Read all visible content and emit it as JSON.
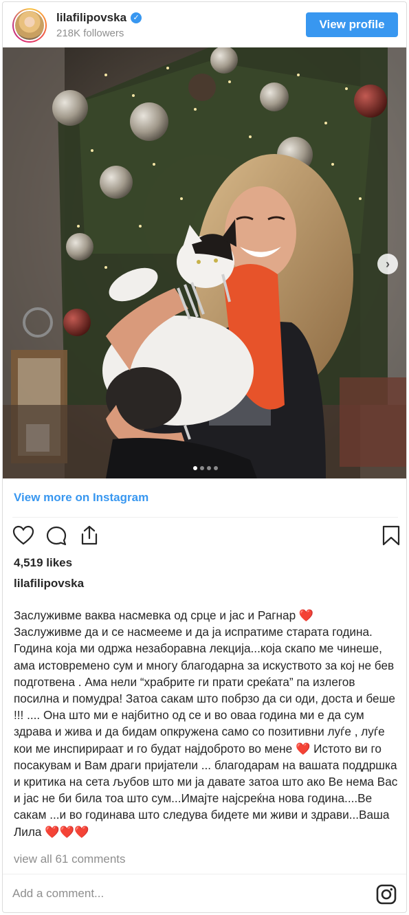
{
  "header": {
    "username": "lilafilipovska",
    "verified_mark": "✓",
    "followers": "218K followers",
    "view_profile_label": "View profile"
  },
  "media": {
    "alt": "lilafilipovska post photo",
    "slide_count": 4,
    "active_slide": 1
  },
  "view_more_label": "View more on Instagram",
  "actions": {
    "like_icon": "heart-icon",
    "comment_icon": "comment-icon",
    "share_icon": "share-icon",
    "save_icon": "bookmark-icon"
  },
  "likes": "4,519 likes",
  "owner_username": "lilafilipovska",
  "caption": "Заслуживме ваква насмевка од срце и јас и Рагнар ❤️\nЗаслуживме да и се насмееме и да ја испратиме старата година. Година која ми одржа незаборавна лекција...која скапо ме чинеше, ама истовремено сум и многу благодарна за искуството за кој не бев подготвена . Ама нели “храбрите ги прати среќата” па излегов посилна и помудра! Затоа сакам што побрзо да си оди, доста и беше !!! .... Она што ми е најбитно од се и во оваа година ми е да сум здрава и жива и да бидам опкружена само со позитивни луѓе , луѓе кои ме инспирираат и го будат најдоброто во мене ❤️ Истото ви го посакувам и Вам драги пријатели ... благодарам на вашата поддршка и критика на сета љубов што ми ја давате затоа што ако Ве нема Вас и јас не би била тоа што сум...Имајте најсреќна нова година....Ве сакам ...и во годинава што следува бидете ми живи и здрави...Ваша Лила ❤️❤️❤️",
  "view_comments": "view all 61 comments",
  "comment_placeholder": "Add a comment...",
  "colors": {
    "accent": "#3897f0",
    "text": "#262626",
    "muted": "#8e8e8e"
  }
}
